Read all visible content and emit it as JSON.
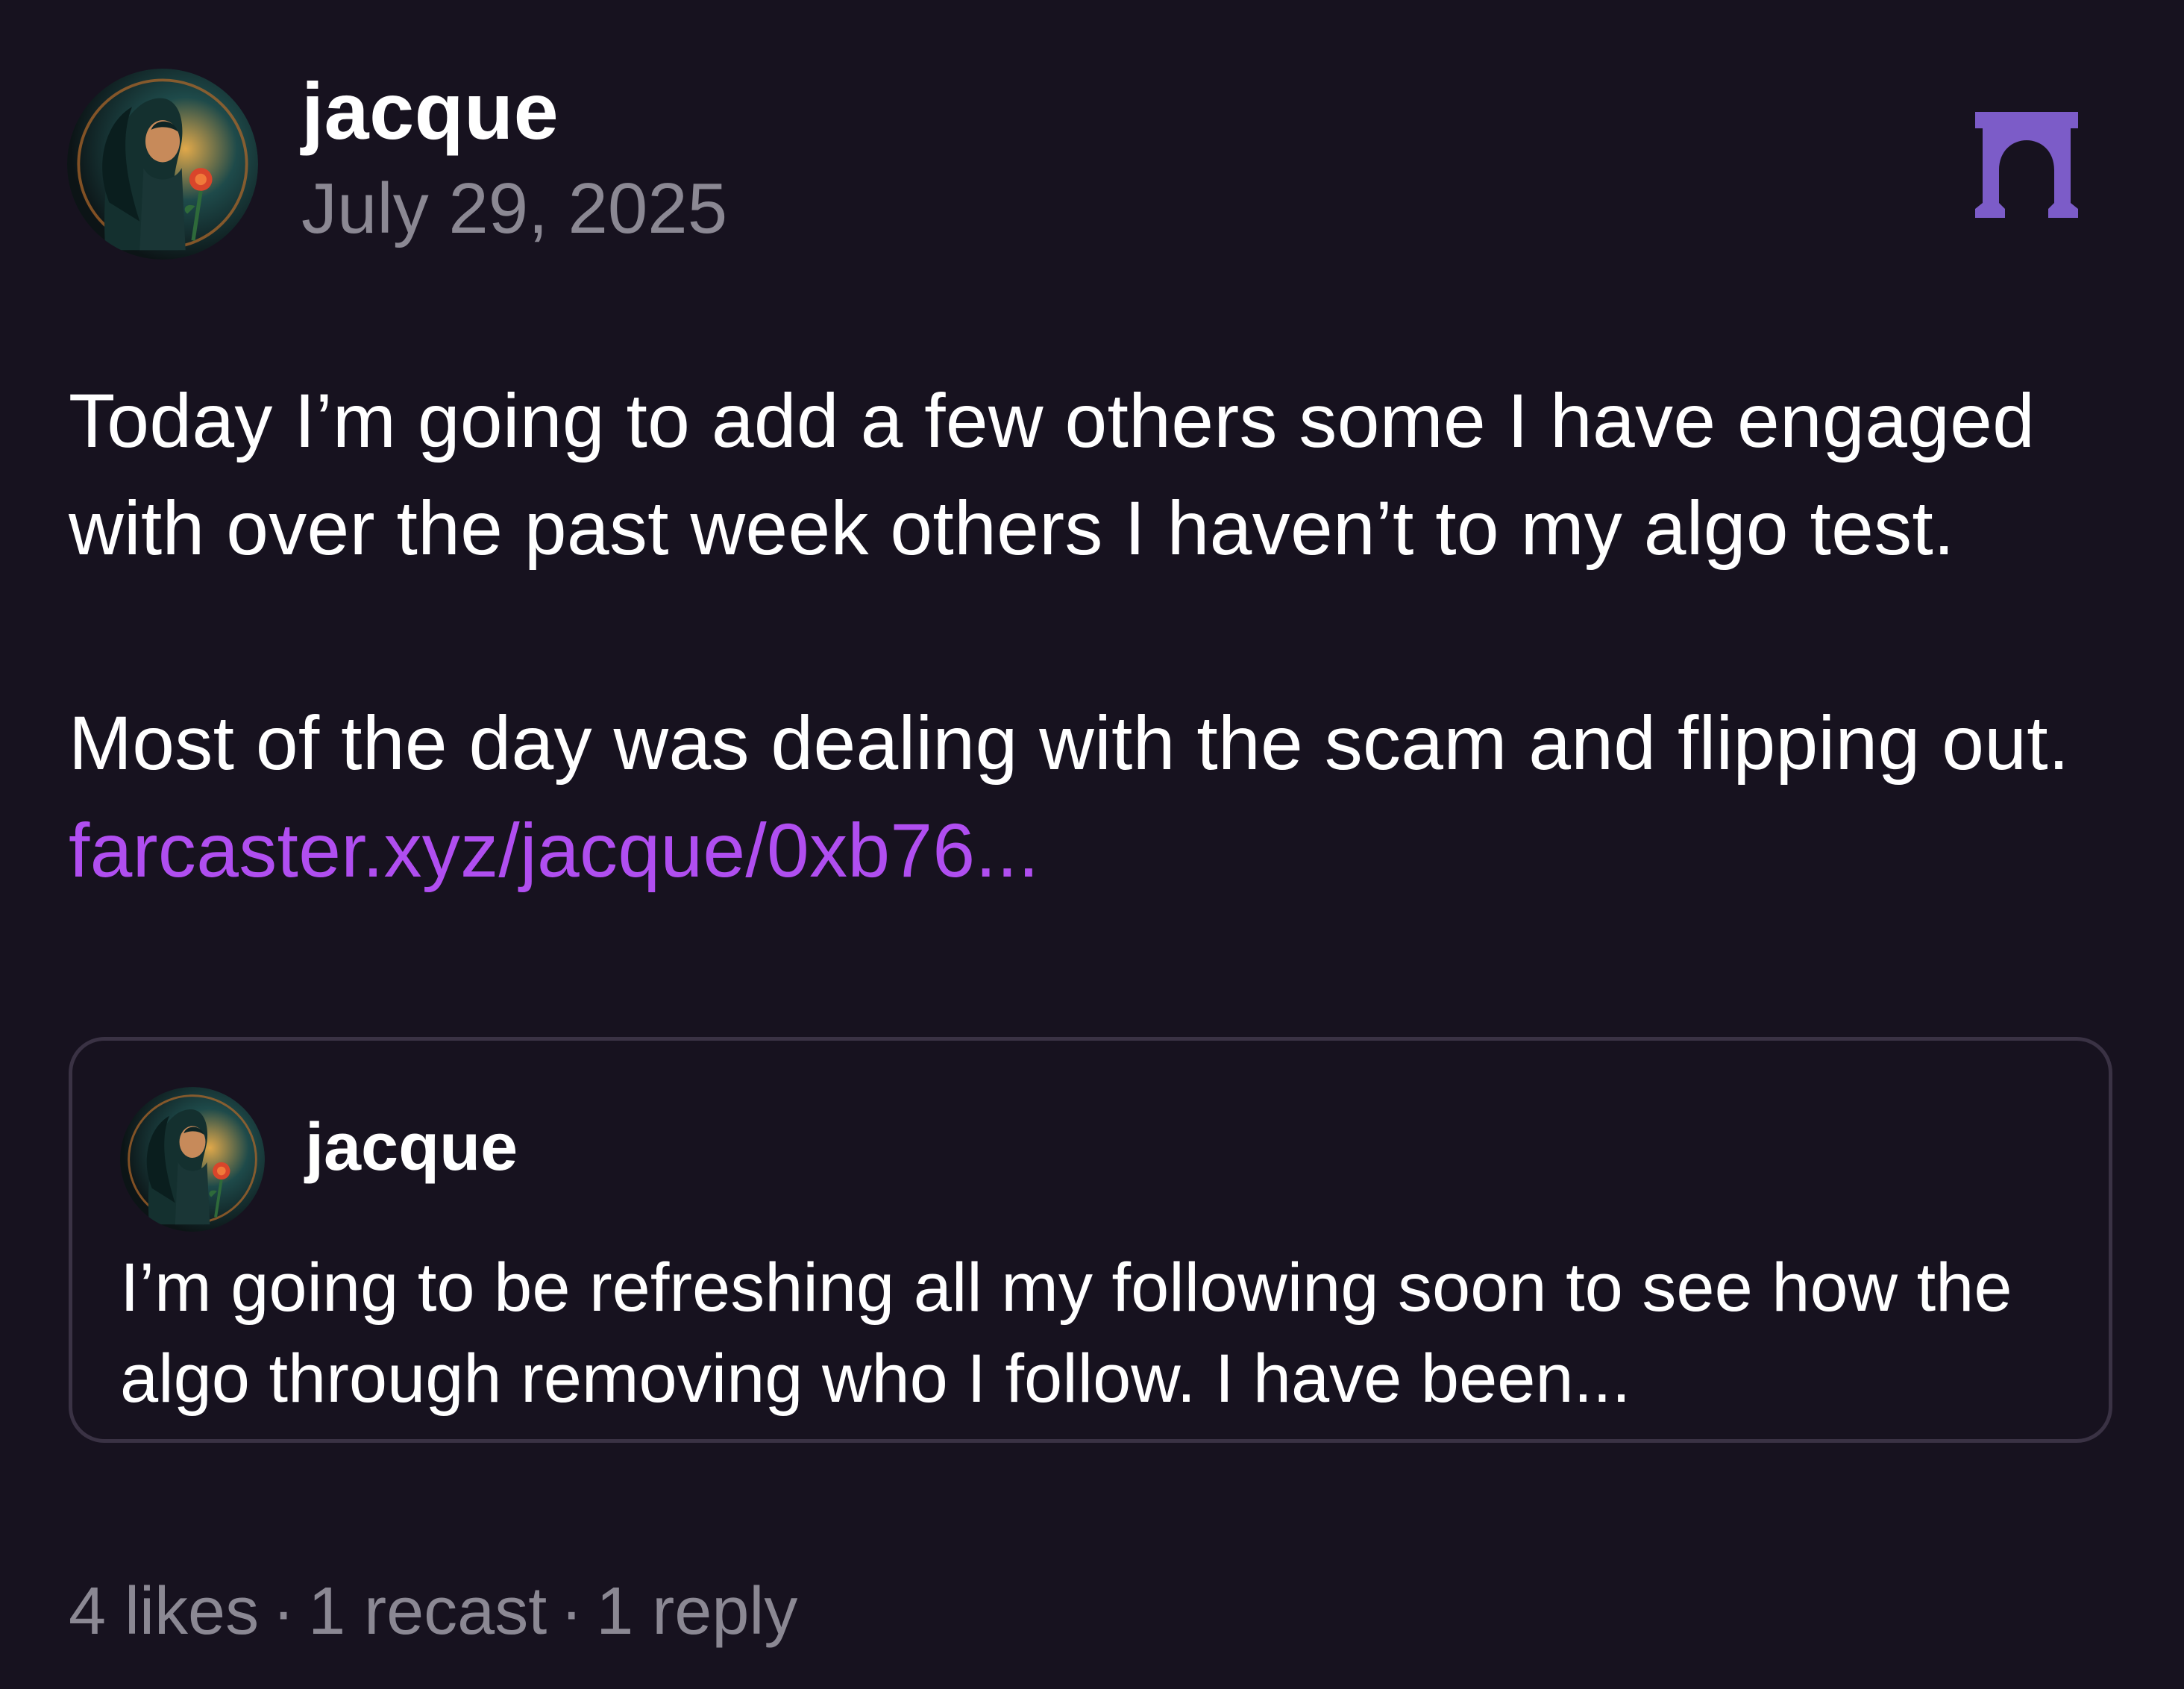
{
  "post": {
    "author": "jacque",
    "date": "July 29, 2025",
    "body_paragraph_1": "Today I’m going to add a few others some I have engaged with over the past week others I haven’t to my algo test.",
    "body_paragraph_2_text": "Most of the day was dealing with the scam and flipping out. ",
    "body_link": "farcaster.xyz/jacque/0xb76..."
  },
  "quote": {
    "author": "jacque",
    "text": "I’m going to be refreshing all my following soon to see how the algo through removing who I follow. I have been..."
  },
  "stats": {
    "likes": "4 likes",
    "recasts": "1 recast",
    "replies": "1 reply",
    "separator": "·"
  },
  "icons": {
    "avatar": "profile-avatar",
    "channel": "arch-icon"
  },
  "colors": {
    "background": "#17121f",
    "link": "#b04ef0",
    "muted": "#8b8893",
    "channel_icon": "#7c5cc8",
    "quote_border": "#3a3244"
  }
}
